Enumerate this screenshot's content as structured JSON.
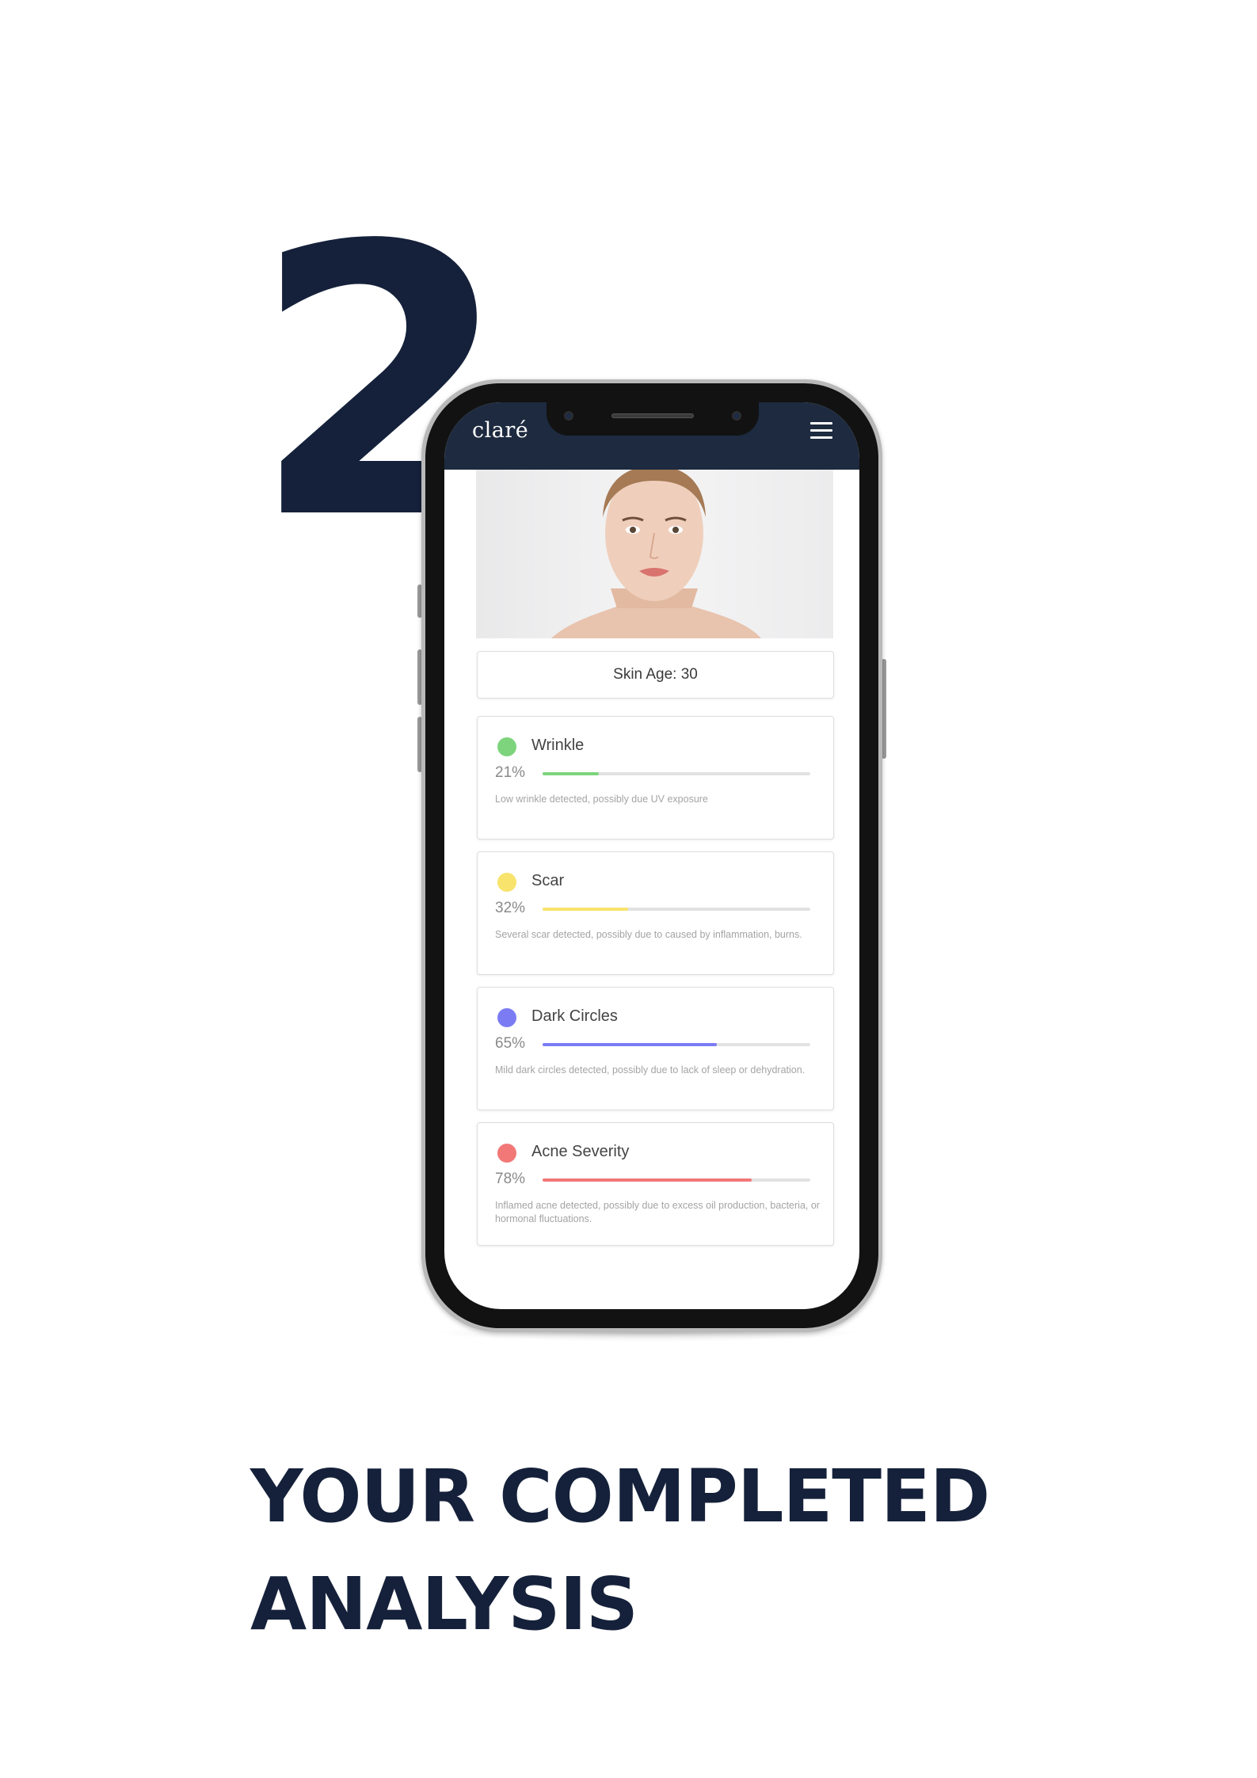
{
  "step": {
    "number": "2"
  },
  "app": {
    "brand": "claré",
    "skin_age_label": "Skin Age: 30",
    "metrics": [
      {
        "name": "Wrinkle",
        "percent_label": "21%",
        "value": 0.21,
        "color": "#7dd47d",
        "description": "Low wrinkle detected, possibly due UV exposure"
      },
      {
        "name": "Scar",
        "percent_label": "32%",
        "value": 0.32,
        "color": "#f8e36c",
        "description": "Several scar detected, possibly due to caused by inflammation, burns."
      },
      {
        "name": "Dark Circles",
        "percent_label": "65%",
        "value": 0.65,
        "color": "#7b7cf3",
        "description": "Mild dark circles detected, possibly due to lack of sleep or dehydration."
      },
      {
        "name": "Acne Severity",
        "percent_label": "78%",
        "value": 0.78,
        "color": "#f27878",
        "description": "Inflamed acne detected, possibly due to excess oil production, bacteria, or hormonal fluctuations."
      }
    ],
    "pager": {
      "count": 3,
      "active": 0
    }
  },
  "headline": {
    "line1": "YOUR COMPLETED",
    "line2": "ANALYSIS"
  },
  "colors": {
    "navy": "#15213a",
    "header_bg": "#1d2a3f"
  }
}
